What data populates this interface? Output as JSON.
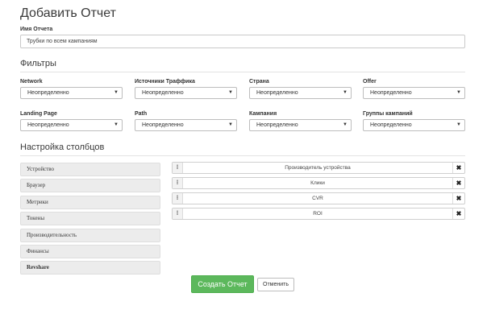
{
  "page": {
    "title": "Добавить Отчет"
  },
  "report_name": {
    "label": "Имя Отчета",
    "value": "Трубки по всем кампаниям"
  },
  "filters": {
    "title": "Фильтры",
    "items": [
      {
        "label": "Network",
        "value": "Неопределенно"
      },
      {
        "label": "Источники Траффика",
        "value": "Неопределенно"
      },
      {
        "label": "Страна",
        "value": "Неопределенно"
      },
      {
        "label": "Offer",
        "value": "Неопределенно"
      },
      {
        "label": "Landing Page",
        "value": "Неопределенно"
      },
      {
        "label": "Path",
        "value": "Неопределенно"
      },
      {
        "label": "Кампания",
        "value": "Неопределенно"
      },
      {
        "label": "Группы кампаний",
        "value": "Неопределенно"
      }
    ]
  },
  "columns": {
    "title": "Настройка столбцов",
    "available": [
      {
        "label": "Устройство"
      },
      {
        "label": "Браузер"
      },
      {
        "label": "Метрики"
      },
      {
        "label": "Токены"
      },
      {
        "label": "Производительность"
      },
      {
        "label": "Финансы"
      },
      {
        "label": "Revshare"
      }
    ],
    "selected": [
      {
        "label": "Производитель устройства"
      },
      {
        "label": "Клики"
      },
      {
        "label": "CVR"
      },
      {
        "label": "ROI"
      }
    ],
    "handle_glyph": "⁝",
    "remove_glyph": "✖"
  },
  "actions": {
    "submit_label": "Создать Отчет",
    "cancel_label": "Отменить"
  },
  "icons": {
    "dropdown": "chevron-down-icon",
    "drag": "drag-handle-icon",
    "remove": "close-icon"
  },
  "colors": {
    "primary": "#5cb85c"
  }
}
